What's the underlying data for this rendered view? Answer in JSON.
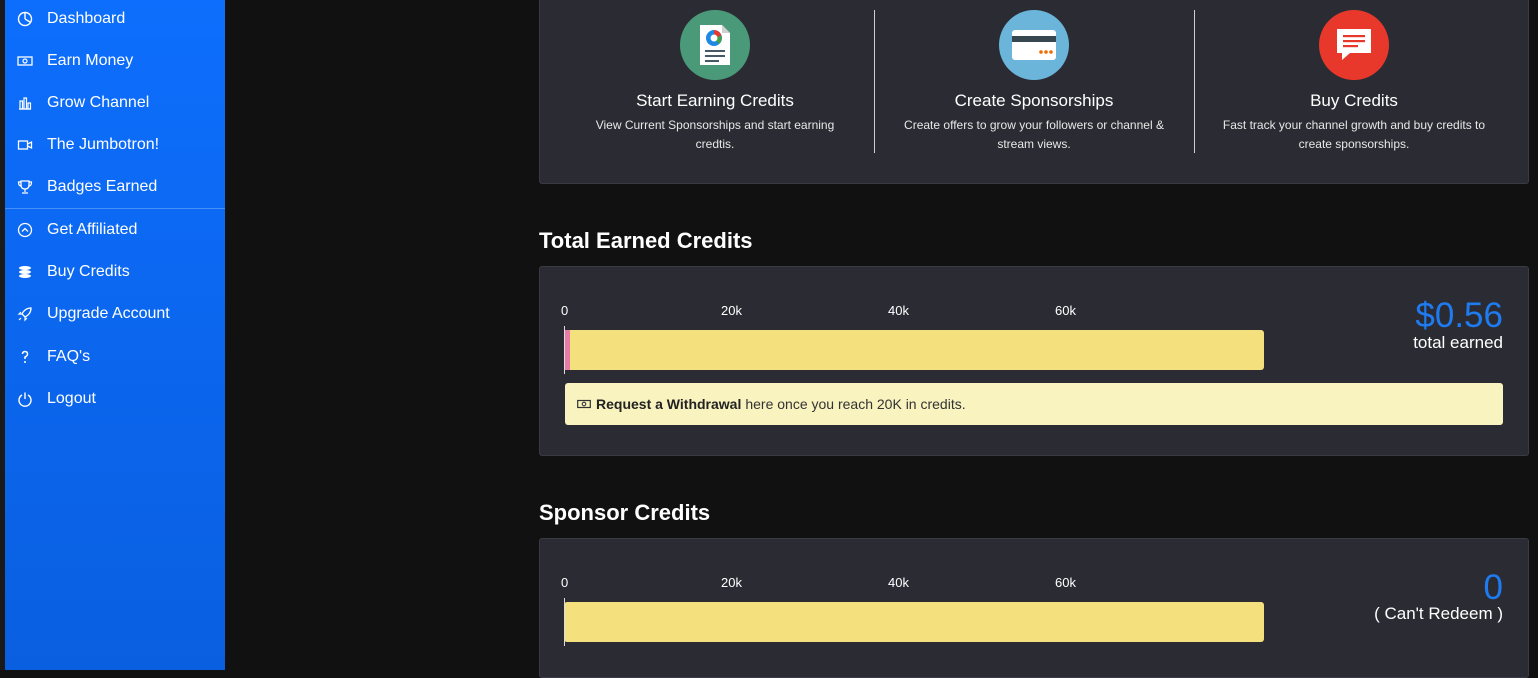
{
  "sidebar": {
    "items": [
      {
        "label": "Dashboard",
        "icon": "dashboard-icon"
      },
      {
        "label": "Earn Money",
        "icon": "money-icon"
      },
      {
        "label": "Grow Channel",
        "icon": "bar-chart-icon"
      },
      {
        "label": "The Jumbotron!",
        "icon": "video-camera-icon"
      },
      {
        "label": "Badges Earned",
        "icon": "trophy-icon"
      },
      {
        "label": "Get Affiliated",
        "icon": "circle-up-icon"
      },
      {
        "label": "Buy Credits",
        "icon": "coins-icon"
      },
      {
        "label": "Upgrade Account",
        "icon": "rocket-icon"
      },
      {
        "label": "FAQ's",
        "icon": "question-icon"
      },
      {
        "label": "Logout",
        "icon": "power-icon"
      }
    ]
  },
  "features": [
    {
      "title": "Start Earning Credits",
      "desc": "View Current Sponsorships and start earning credtis.",
      "icon": "report-document-icon",
      "color": "#4a9a79"
    },
    {
      "title": "Create Sponsorships",
      "desc": "Create offers to grow your followers or channel & stream views.",
      "icon": "credit-card-icon",
      "color": "#6bb5da"
    },
    {
      "title": "Buy Credits",
      "desc": "Fast track your channel growth and buy credits to create sponsorships.",
      "icon": "chat-message-icon",
      "color": "#e8382b"
    }
  ],
  "total_earned": {
    "section_title": "Total Earned Credits",
    "ticks": [
      "0",
      "20k",
      "40k",
      "60k"
    ],
    "progress_fraction": 0.007,
    "amount": "$0.56",
    "amount_label": "total earned",
    "notice_bold": "Request a Withdrawal",
    "notice_text": "here once you reach 20K in credits."
  },
  "sponsor_credits": {
    "section_title": "Sponsor Credits",
    "ticks": [
      "0",
      "20k",
      "40k",
      "60k"
    ],
    "progress_fraction": 0,
    "amount": "0",
    "amount_label": "( Can't Redeem )"
  },
  "colors": {
    "sidebar": "#0d6efd",
    "accent_amount": "#1e7bf0",
    "bar": "#f5e07e",
    "bar_fill": "#e97aa6",
    "card": "#2b2b33"
  }
}
